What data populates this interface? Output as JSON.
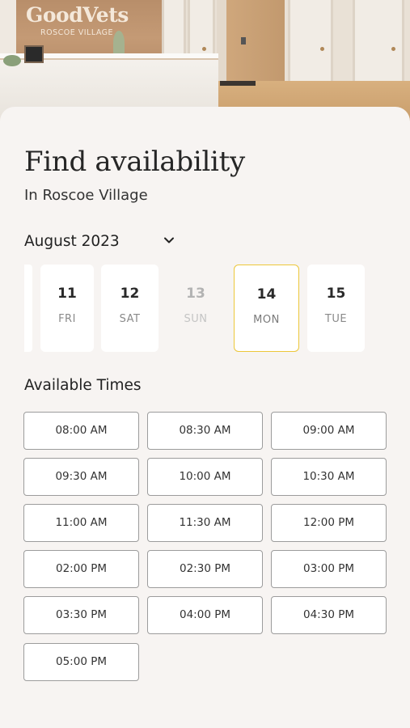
{
  "hero": {
    "brand_name": "GoodVets",
    "brand_location": "ROSCOE VILLAGE"
  },
  "page": {
    "title": "Find availability",
    "subtitle": "In Roscoe Village"
  },
  "month_picker": {
    "value": "August 2023",
    "icon": "chevron-down-icon"
  },
  "dates": [
    {
      "day": "11",
      "weekday": "FRI",
      "state": "available"
    },
    {
      "day": "12",
      "weekday": "SAT",
      "state": "available"
    },
    {
      "day": "13",
      "weekday": "SUN",
      "state": "disabled"
    },
    {
      "day": "14",
      "weekday": "MON",
      "state": "selected"
    },
    {
      "day": "15",
      "weekday": "TUE",
      "state": "available"
    }
  ],
  "colors": {
    "selected_border": "#ecc73a",
    "background": "#f7f4f2",
    "slot_border": "#9c9c9c"
  },
  "times": {
    "heading": "Available Times",
    "slots": [
      "08:00 AM",
      "08:30 AM",
      "09:00 AM",
      "09:30 AM",
      "10:00 AM",
      "10:30 AM",
      "11:00 AM",
      "11:30 AM",
      "12:00 PM",
      "02:00 PM",
      "02:30 PM",
      "03:00 PM",
      "03:30 PM",
      "04:00 PM",
      "04:30 PM",
      "05:00 PM"
    ]
  }
}
